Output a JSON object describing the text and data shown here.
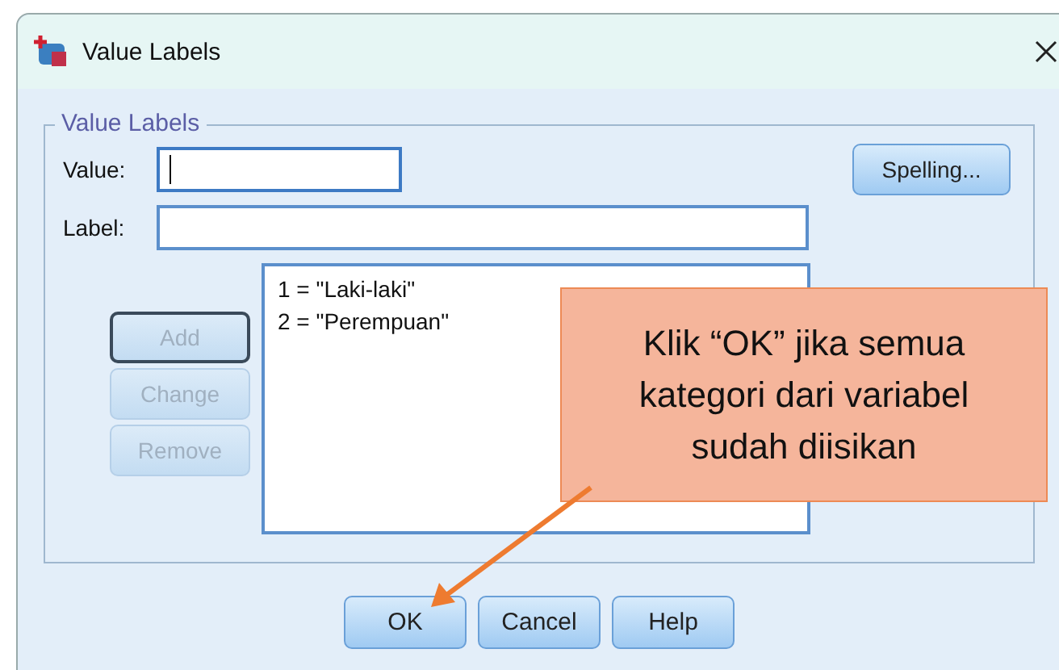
{
  "window": {
    "title": "Value Labels"
  },
  "group": {
    "title": "Value Labels"
  },
  "value_field": {
    "label": "Value:",
    "focused": true
  },
  "label_field": {
    "label": "Label:",
    "focused": false
  },
  "spelling_button": "Spelling...",
  "side_buttons": [
    {
      "label": "Add",
      "disabled": true,
      "focused": true
    },
    {
      "label": "Change",
      "disabled": true,
      "focused": false
    },
    {
      "label": "Remove",
      "disabled": true,
      "focused": false
    }
  ],
  "value_list": [
    "1 = \"Laki-laki\"",
    "2 = \"Perempuan\""
  ],
  "buttons": [
    {
      "label": "OK"
    },
    {
      "label": "Cancel"
    },
    {
      "label": "Help"
    }
  ],
  "callout": {
    "text": "Klik “OK” jika semua kategori dari variabel sudah diisikan"
  }
}
